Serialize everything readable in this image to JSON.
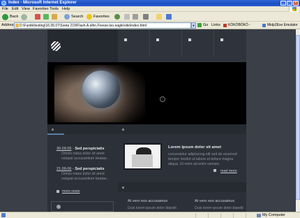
{
  "window": {
    "title": "Index - Microsoft Internet Explorer"
  },
  "menu": [
    "File",
    "Edit",
    "View",
    "Favorites",
    "Tools",
    "Help"
  ],
  "toolbar": {
    "back_label": "Back",
    "search_label": "Search",
    "favorites_label": "Favorites"
  },
  "address": {
    "label": "Address",
    "value": "D:\\Funtik\\testing\\16.05.07\\Sveta 219\\Flash.A.elhn.Freeze.leo.eagle\\site\\index.html",
    "go_label": "Go",
    "links_label": "Links",
    "plugin_label": "KÖKÖBÖKÖ -",
    "emulator_label": "Midp2Exe Emulator"
  },
  "news": [
    {
      "date": "30.09.06",
      "separator": " - ",
      "headline": "Sed perspiciatis",
      "text": "Omnis natus dolor sit amet volupat accusantium beatae..."
    },
    {
      "date": "21.09.06",
      "separator": " - ",
      "headline": "Sed perspiciatis",
      "text": "Omnis natus dolor sit amet volupat accusantium beatae..."
    }
  ],
  "more_news": "more news",
  "feature": {
    "title": "Lorem ipsum dolor sit amet",
    "text": "consectetur adipisicing elit sed do eiusmod tempor incidnt ut labore et dolore magna aliqua. Ut enim ad enim veniam.",
    "read_more": "read more"
  },
  "bottom": {
    "col1_title": "At vero eos accusamus",
    "col1_sub": "Duis lorem ipsum dolor blandit",
    "col2_title": "At vero eos accusamus",
    "col2_sub": "Duis lorem ipsum dolor blandit"
  },
  "status": {
    "zone": "My Computer"
  },
  "colors": {
    "site_background": "#2c3038",
    "page_background": "#3a3f48",
    "accent_bar": "#5b7fa8",
    "titlebar": "#1b4fc2"
  }
}
